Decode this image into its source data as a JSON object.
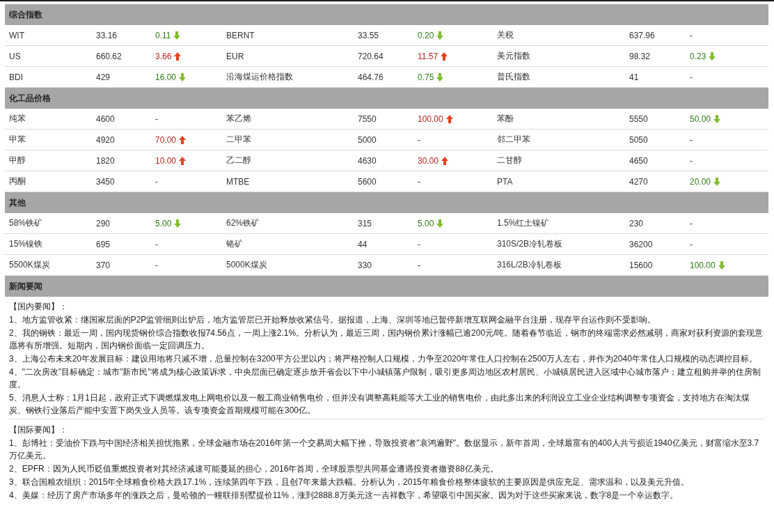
{
  "sections": [
    {
      "kind": "quotes",
      "title": "综合指数",
      "rows": [
        {
          "items": [
            {
              "name": "WIT",
              "value": "33.16",
              "change": "0.11",
              "kind": "down"
            },
            {
              "name": "BERNT",
              "value": "33.55",
              "change": "0.20",
              "kind": "down"
            },
            {
              "name": "关税",
              "value": "637.96",
              "change": "-",
              "kind": "flat"
            }
          ]
        },
        {
          "items": [
            {
              "name": "US",
              "value": "660.62",
              "change": "3.66",
              "kind": "up"
            },
            {
              "name": "EUR",
              "value": "720.64",
              "change": "11.57",
              "kind": "up"
            },
            {
              "name": "美元指数",
              "value": "98.32",
              "change": "0.23",
              "kind": "down"
            }
          ]
        },
        {
          "items": [
            {
              "name": "BDI",
              "value": "429",
              "change": "16.00",
              "kind": "down"
            },
            {
              "name": "沿海煤运价格指数",
              "value": "464.76",
              "change": "0.75",
              "kind": "down"
            },
            {
              "name": "普氏指数",
              "value": "41",
              "change": "-",
              "kind": "flat"
            }
          ]
        }
      ]
    },
    {
      "kind": "quotes",
      "title": "化工品价格",
      "rows": [
        {
          "items": [
            {
              "name": "纯苯",
              "value": "4600",
              "change": "-",
              "kind": "flat"
            },
            {
              "name": "苯乙烯",
              "value": "7550",
              "change": "100.00",
              "kind": "up"
            },
            {
              "name": "苯酚",
              "value": "5550",
              "change": "50.00",
              "kind": "down"
            }
          ]
        },
        {
          "items": [
            {
              "name": "甲苯",
              "value": "4920",
              "change": "70.00",
              "kind": "up"
            },
            {
              "name": "二甲苯",
              "value": "5000",
              "change": "-",
              "kind": "flat"
            },
            {
              "name": "邻二甲苯",
              "value": "5050",
              "change": "-",
              "kind": "flat"
            }
          ]
        },
        {
          "items": [
            {
              "name": "甲醇",
              "value": "1820",
              "change": "10.00",
              "kind": "up"
            },
            {
              "name": "乙二醇",
              "value": "4630",
              "change": "30.00",
              "kind": "up"
            },
            {
              "name": "二甘醇",
              "value": "4650",
              "change": "-",
              "kind": "flat"
            }
          ]
        },
        {
          "items": [
            {
              "name": "丙酮",
              "value": "3450",
              "change": "-",
              "kind": "flat"
            },
            {
              "name": "MTBE",
              "value": "5600",
              "change": "-",
              "kind": "flat"
            },
            {
              "name": "PTA",
              "value": "4270",
              "change": "20.00",
              "kind": "down"
            }
          ]
        }
      ]
    },
    {
      "kind": "quotes",
      "title": "其他",
      "rows": [
        {
          "items": [
            {
              "name": "58%铁矿",
              "value": "290",
              "change": "5.00",
              "kind": "down"
            },
            {
              "name": "62%铁矿",
              "value": "315",
              "change": "5.00",
              "kind": "down"
            },
            {
              "name": "1.5%红土镍矿",
              "value": "230",
              "change": "-",
              "kind": "flat"
            }
          ]
        },
        {
          "items": [
            {
              "name": "15%镍铁",
              "value": "695",
              "change": "-",
              "kind": "flat"
            },
            {
              "name": "铬矿",
              "value": "44",
              "change": "-",
              "kind": "flat"
            },
            {
              "name": "310S/2B冷轧卷板",
              "value": "36200",
              "change": "-",
              "kind": "flat"
            }
          ]
        },
        {
          "items": [
            {
              "name": "5500K煤炭",
              "value": "370",
              "change": "-",
              "kind": "flat"
            },
            {
              "name": "5000K煤炭",
              "value": "330",
              "change": "-",
              "kind": "flat"
            },
            {
              "name": "316L/2B冷轧卷板",
              "value": "15600",
              "change": "100.00",
              "kind": "down"
            }
          ]
        }
      ]
    },
    {
      "kind": "news",
      "title": "新闻要闻",
      "groups": [
        {
          "heading": "【国内要闻】：",
          "items": [
            "1、地方监管收紧：继国家层面的P2P监管细则出炉后，地方监管层已开始释放收紧信号。据报道，上海、深圳等地已暂停新增互联网金融平台注册，现存平台运作则不受影响。",
            "2、我的钢铁：最近一周，国内现货钢价综合指数收报74.56点，一周上涨2.1%。分析认为，最近三周，国内钢价累计涨幅已逾200元/吨。随着春节临近，钢市的终端需求必然减弱，商家对获利资源的套现意愿将有所增强。短期内，国内钢价面临一定回调压力。",
            "3、上海公布未来20年发展目标：建设用地将只减不增，总量控制在3200平方公里以内；将严格控制人口规模，力争至2020年常住人口控制在2500万人左右，并作为2040年常住人口规模的动态调控目标。",
            "4、\"二次房改\"目标确定：城市\"新市民\"将成为核心政策诉求，中央层面已确定逐步放开省会以下中小城镇落户限制，吸引更多周边地区农村居民、小城镇居民进入区域中心城市落户；建立租购并举的住房制度。",
            "5、消息人士称：1月1日起，政府正式下调燃煤发电上网电价以及一般工商业销售电价，但并没有调整高耗能等大工业的销售电价，由此多出来的利润设立工业企业结构调整专项资金，支持地方在淘汰煤炭、钢铁行业落后产能中安置下岗失业人员等。该专项资金首期规模可能在300亿。"
          ]
        },
        {
          "heading": "【国际要闻】：",
          "items": [
            "1、彭博社：受油价下跌与中国经济相关担忧拖累，全球金融市场在2016年第一个交易周大幅下挫，导致投资者\"哀鸿遍野\"。数据显示，新年首周，全球最富有的400人共亏损近1940亿美元，财富缩水至3.7万亿美元。",
            "2、EPFR：因为人民币贬值重燃投资者对其经济减速可能蔓延的担心，2016年首周，全球股票型共同基金遭遇投资者撤资88亿美元。",
            "3、联合国粮农组织：2015年全球粮食价格大跌17.1%，连续第四年下跌，且创7年来最大跌幅。分析认为，2015年粮食价格整体疲软的主要原因是供应充足、需求温和，以及美元升值。",
            "4、美媒：经历了房产市场多年的涨跌之后，曼哈顿的一幢联排别墅提价11%，涨到2888.8万美元这一吉祥数字，希望吸引中国买家。因为对于这些买家来说，数字8是一个幸运数字。"
          ]
        }
      ]
    }
  ]
}
